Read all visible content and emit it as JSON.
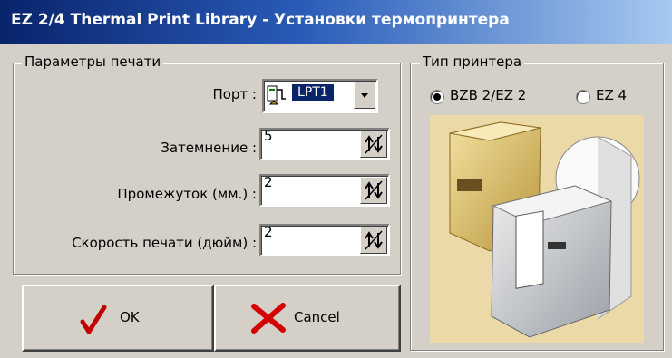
{
  "window": {
    "title": "EZ 2/4 Thermal Print Library - Установки термопринтера"
  },
  "print_params": {
    "legend": "Параметры печати",
    "port_label": "Порт :",
    "port_value": "LPT1",
    "darkness_label": "Затемнение :",
    "darkness_value": "5",
    "gap_label": "Промежуток  (мм.) :",
    "gap_value": "2",
    "speed_label": "Скорость печати (дюйм) :",
    "speed_value": "2"
  },
  "buttons": {
    "ok_label": "OK",
    "cancel_label": "Cancel"
  },
  "printer_type": {
    "legend": "Тип принтера",
    "options": [
      {
        "label": "BZB 2/EZ 2",
        "selected": true
      },
      {
        "label": "EZ 4",
        "selected": false
      }
    ]
  },
  "colors": {
    "title_start": "#08246b",
    "title_end": "#a6caf0",
    "port_highlight": "#0a246a"
  }
}
